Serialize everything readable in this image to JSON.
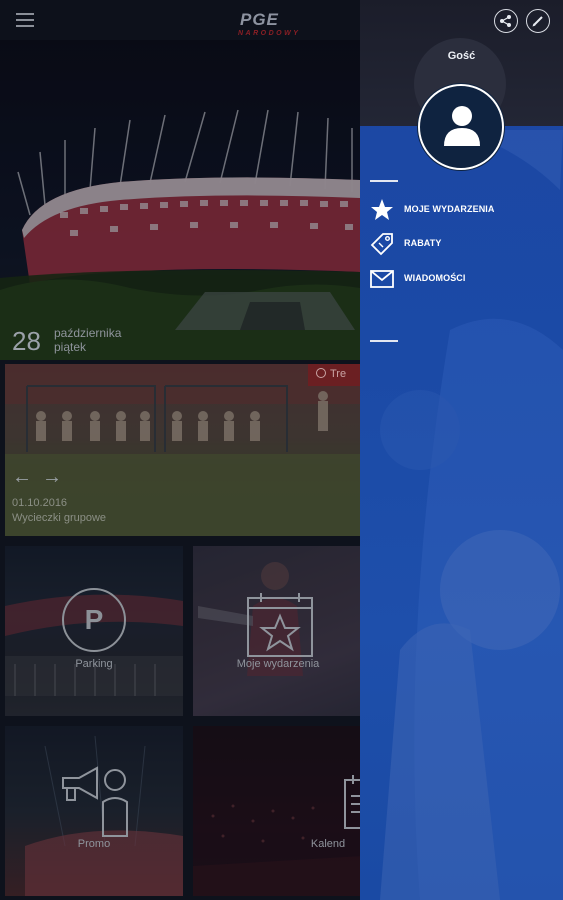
{
  "header": {
    "logo_main": "PGE",
    "logo_sub": "NARODOWY"
  },
  "hero": {
    "day": "28",
    "month": "października",
    "weekday": "piątek"
  },
  "event": {
    "badge": "Tre",
    "date": "01.10.2016",
    "title": "Wycieczki grupowe"
  },
  "tiles": {
    "parking": {
      "letter": "P",
      "label": "Parking"
    },
    "my_events": {
      "label": "Moje wydarzenia"
    },
    "promo": {
      "label": "Promo"
    },
    "calendar": {
      "label": "Kalend"
    }
  },
  "drawer": {
    "guest_name": "Gość",
    "items": [
      {
        "label": "MOJE WYDARZENIA",
        "icon": "star-icon"
      },
      {
        "label": "RABATY",
        "icon": "tag-icon"
      },
      {
        "label": "WIADOMOŚCI",
        "icon": "envelope-icon"
      }
    ]
  },
  "colors": {
    "drawer_blue": "#1c46a3",
    "accent_red": "#8a1f25",
    "dark_bg": "#0e121c"
  }
}
